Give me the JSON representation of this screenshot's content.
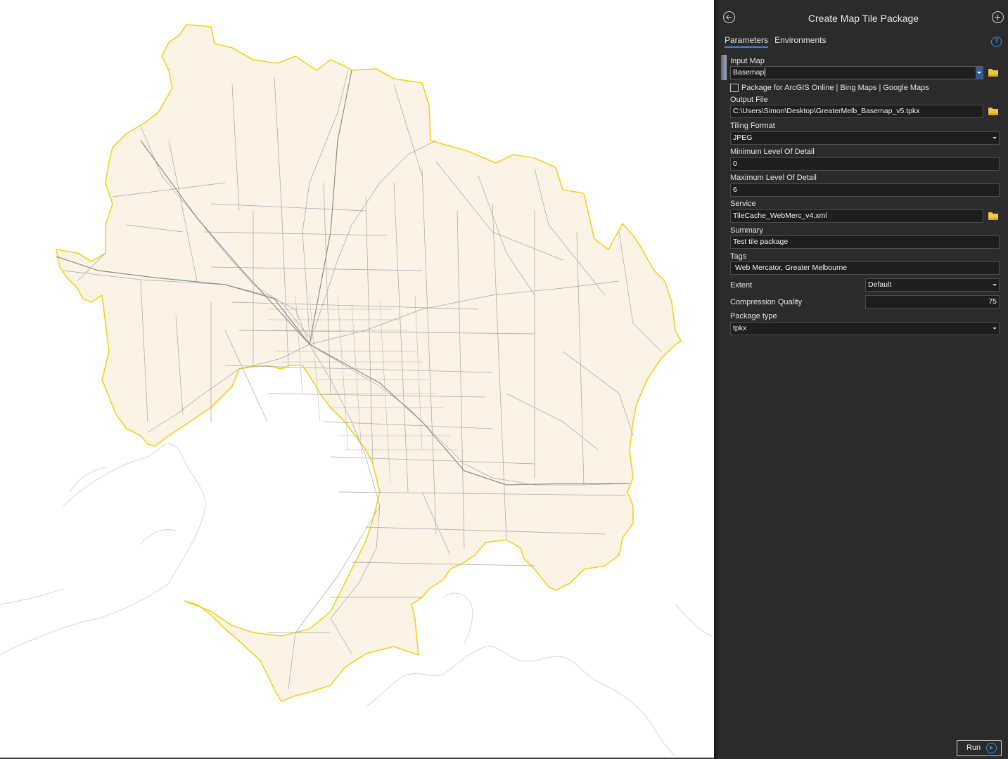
{
  "pane": {
    "title": "Create Map Tile Package",
    "tabs": [
      {
        "label": "Parameters",
        "active": true
      },
      {
        "label": "Environments",
        "active": false
      }
    ],
    "help_glyph": "?"
  },
  "params": {
    "input_map": {
      "label": "Input Map",
      "value": "Basemap"
    },
    "package_for_online": {
      "label": "Package for ArcGIS Online | Bing Maps | Google Maps",
      "checked": false
    },
    "output_file": {
      "label": "Output File",
      "value": "C:\\Users\\Simon\\Desktop\\GreaterMelb_Basemap_v5.tpkx"
    },
    "tiling_format": {
      "label": "Tiling Format",
      "value": "JPEG"
    },
    "min_lod": {
      "label": "Minimum Level Of Detail",
      "value": "0"
    },
    "max_lod": {
      "label": "Maximum Level Of Detail",
      "value": "6"
    },
    "service": {
      "label": "Service",
      "value": "TileCache_WebMerc_v4.xml"
    },
    "summary": {
      "label": "Summary",
      "value": "Test tile package"
    },
    "tags": {
      "label": "Tags",
      "value": "Web Mercator, Greater Melbourne"
    },
    "extent": {
      "label": "Extent",
      "value": "Default"
    },
    "compression_quality": {
      "label": "Compression Quality",
      "value": "75"
    },
    "package_type": {
      "label": "Package type",
      "value": "tpkx"
    }
  },
  "footer": {
    "run_label": "Run"
  },
  "colors": {
    "boundary": "#f7d21c",
    "land_fill": "#fbf3e6",
    "roads": "#a8a8a8",
    "accent": "#3c8ad4",
    "pane_bg": "#2b2b2b"
  },
  "icons": [
    "back-icon",
    "add-icon",
    "help-icon",
    "folder-icon",
    "run-icon"
  ]
}
